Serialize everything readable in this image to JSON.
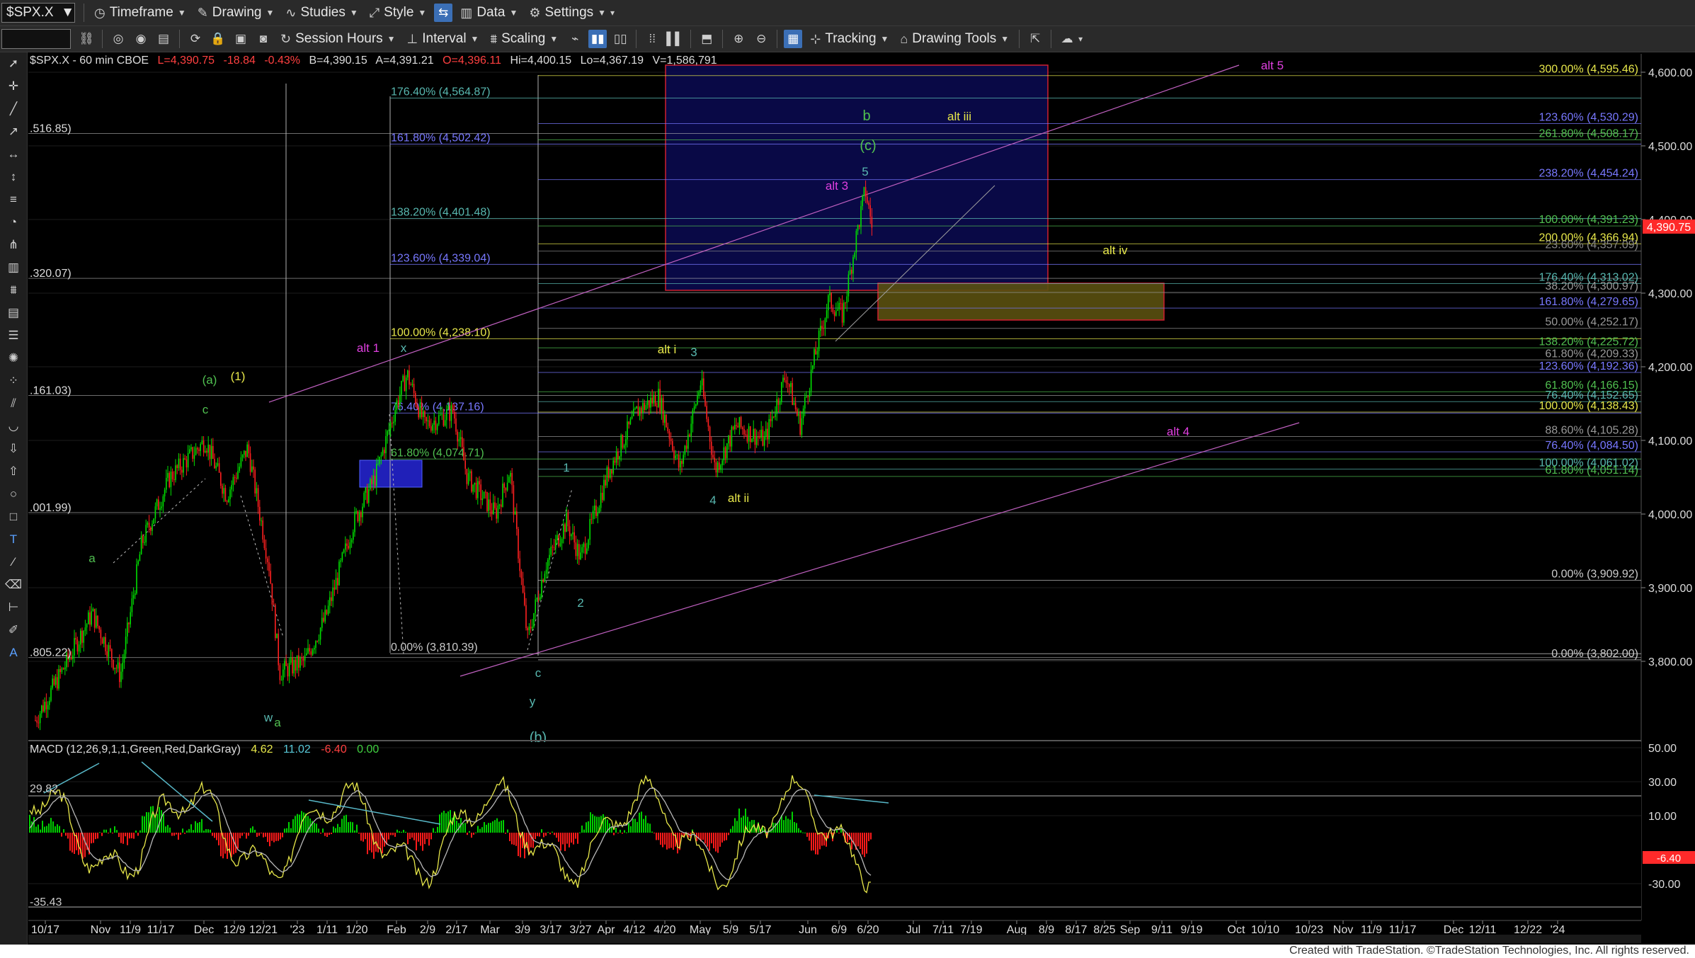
{
  "toolbar1": {
    "symbol": "$SPX.X",
    "menus": [
      "Timeframe",
      "Drawing",
      "Studies",
      "Style",
      "Data",
      "Settings"
    ]
  },
  "toolbar2": {
    "labels": [
      "Session Hours",
      "Interval",
      "Scaling",
      "Tracking",
      "Drawing Tools"
    ]
  },
  "chart_header": {
    "symbol_info": "$SPX.X - 60 min  CBOE",
    "last": "L=4,390.75",
    "change": "-18.84",
    "change_pct": "-0.43%",
    "bid": "B=4,390.15",
    "ask": "A=4,391.21",
    "open": "O=4,396.11",
    "high": "Hi=4,400.15",
    "low": "Lo=4,367.19",
    "volume": "V=1,586,791"
  },
  "colors": {
    "up": "#00e000",
    "down": "#ff2020",
    "fib_yellow": "#e8e84a",
    "fib_blue": "#7878ff",
    "fib_teal": "#58b8b0",
    "fib_green": "#50c050",
    "magenta": "#e040e0",
    "grid": "#2a2a2a",
    "last_price_bg": "#ff2a2a"
  },
  "price_axis": {
    "ticks": [
      "4,600.00",
      "4,500.00",
      "4,400.00",
      "4,300.00",
      "4,200.00",
      "4,100.00",
      "4,000.00",
      "3,900.00",
      "3,800.00"
    ],
    "last_price": "4,390.75"
  },
  "date_axis": {
    "ticks": [
      "10/17",
      "Nov",
      "11/9",
      "11/17",
      "Dec",
      "12/9",
      "12/21",
      "'23",
      "1/11",
      "1/20",
      "Feb",
      "2/9",
      "2/17",
      "Mar",
      "3/9",
      "3/17",
      "3/27",
      "Apr",
      "4/12",
      "4/20",
      "May",
      "5/9",
      "5/17",
      "Jun",
      "6/9",
      "6/20",
      "Jul",
      "7/11",
      "7/19",
      "Aug",
      "8/9",
      "8/17",
      "8/25",
      "Sep",
      "9/11",
      "9/19",
      "Oct",
      "10/10",
      "10/23",
      "Nov",
      "11/9",
      "11/17",
      "Dec",
      "12/11",
      "12/22",
      "'24"
    ]
  },
  "left_prices": [
    ".516.85)",
    ".320.07)",
    ".161.03)",
    ".001.99)",
    ".805.22)"
  ],
  "fib_left": [
    {
      "text": "176.40% (4,564.87)",
      "price": 4564.87,
      "color": "#58b8b0"
    },
    {
      "text": "161.80% (4,502.42)",
      "price": 4502.42,
      "color": "#7878ff"
    },
    {
      "text": "138.20% (4,401.48)",
      "price": 4401.48,
      "color": "#58b8b0"
    },
    {
      "text": "123.60% (4,339.04)",
      "price": 4339.04,
      "color": "#7878ff"
    },
    {
      "text": "100.00% (4,238.10)",
      "price": 4238.1,
      "color": "#e8e84a"
    },
    {
      "text": "76.40% (4,137.16)",
      "price": 4137.16,
      "color": "#7878ff"
    },
    {
      "text": "61.80% (4,074.71)",
      "price": 4074.71,
      "color": "#50c050"
    },
    {
      "text": "0.00% (3,810.39)",
      "price": 3810.39,
      "color": "#cccccc"
    }
  ],
  "fib_right": [
    {
      "text": "300.00% (4,595.46)",
      "price": 4595.46,
      "color": "#e8e84a"
    },
    {
      "text": "123.60% (4,530.29)",
      "price": 4530.29,
      "color": "#7878ff"
    },
    {
      "text": "261.80% (4,508.17)",
      "price": 4508.17,
      "color": "#50c050"
    },
    {
      "text": "238.20% (4,454.24)",
      "price": 4454.24,
      "color": "#7878ff"
    },
    {
      "text": "100.00% (4,391.23)",
      "price": 4391.23,
      "color": "#50c050"
    },
    {
      "text": "200.00% (4,366.94)",
      "price": 4366.94,
      "color": "#e8e84a"
    },
    {
      "text": "23.60% (4,357.09)",
      "price": 4357.09,
      "color": "#888888"
    },
    {
      "text": "176.40% (4,313.02)",
      "price": 4313.02,
      "color": "#58b8b0"
    },
    {
      "text": "38.20% (4,300.97)",
      "price": 4300.97,
      "color": "#999999"
    },
    {
      "text": "161.80% (4,279.65)",
      "price": 4279.65,
      "color": "#7878ff"
    },
    {
      "text": "50.00% (4,252.17)",
      "price": 4252.17,
      "color": "#999999"
    },
    {
      "text": "138.20% (4,225.72)",
      "price": 4225.72,
      "color": "#50c050"
    },
    {
      "text": "61.80% (4,209.33)",
      "price": 4209.33,
      "color": "#999999"
    },
    {
      "text": "123.60% (4,192.36)",
      "price": 4192.36,
      "color": "#7878ff"
    },
    {
      "text": "61.80% (4,166.15)",
      "price": 4166.15,
      "color": "#50c050"
    },
    {
      "text": "76.40% (4,152.65)",
      "price": 4152.65,
      "color": "#58b8b0"
    },
    {
      "text": "100.00% (4,138.43)",
      "price": 4138.43,
      "color": "#e8e84a"
    },
    {
      "text": "88.60% (4,105.28)",
      "price": 4105.28,
      "color": "#999999"
    },
    {
      "text": "76.40% (4,084.50)",
      "price": 4084.5,
      "color": "#7878ff"
    },
    {
      "text": "100.00% (4,061.02)",
      "price": 4061.02,
      "color": "#58b8b0"
    },
    {
      "text": "61.80% (4,051.14)",
      "price": 4051.14,
      "color": "#50c050"
    },
    {
      "text": "0.00% (3,909.92)",
      "price": 3909.92,
      "color": "#cccccc"
    },
    {
      "text": "0.00% (3,802.00)",
      "price": 3802.0,
      "color": "#cccccc"
    }
  ],
  "wave_labels": [
    {
      "text": "alt 5",
      "color": "#e040e0"
    },
    {
      "text": "b",
      "color": "#50c050"
    },
    {
      "text": "alt iii",
      "color": "#e8e84a"
    },
    {
      "text": "(c)",
      "color": "#50c050"
    },
    {
      "text": "5",
      "color": "#58b8b0"
    },
    {
      "text": "alt 3",
      "color": "#e040e0"
    },
    {
      "text": "alt iv",
      "color": "#e8e84a"
    },
    {
      "text": "alt 1",
      "color": "#e040e0"
    },
    {
      "text": "x",
      "color": "#58b8b0"
    },
    {
      "text": "alt i",
      "color": "#e8e84a"
    },
    {
      "text": "3",
      "color": "#58b8b0"
    },
    {
      "text": "(a)",
      "color": "#50c050"
    },
    {
      "text": "(1)",
      "color": "#e8e84a"
    },
    {
      "text": "c",
      "color": "#50c050"
    },
    {
      "text": "alt 4",
      "color": "#e040e0"
    },
    {
      "text": "1",
      "color": "#58b8b0"
    },
    {
      "text": "4",
      "color": "#58b8b0"
    },
    {
      "text": "alt ii",
      "color": "#e8e84a"
    },
    {
      "text": "a",
      "color": "#50c050"
    },
    {
      "text": "2",
      "color": "#58b8b0"
    },
    {
      "text": "c",
      "color": "#58b8b0"
    },
    {
      "text": "w",
      "color": "#58b8b0"
    },
    {
      "text": "a",
      "color": "#50c050"
    },
    {
      "text": "y",
      "color": "#58b8b0"
    },
    {
      "text": "(b)",
      "color": "#58b8b0"
    }
  ],
  "macd": {
    "label": "MACD (12,26,9,1,1,Green,Red,DarkGray)",
    "values": [
      "4.62",
      "11.02",
      "-6.40",
      "0.00"
    ],
    "ticks": [
      "50.00",
      "30.00",
      "10.00",
      "-30.00"
    ],
    "current": "-6.40",
    "hi_mark": "29.82",
    "lo_mark": "-35.43"
  },
  "footer": {
    "text": "Created with TradeStation. ©TradeStation Technologies, Inc. All rights reserved."
  }
}
